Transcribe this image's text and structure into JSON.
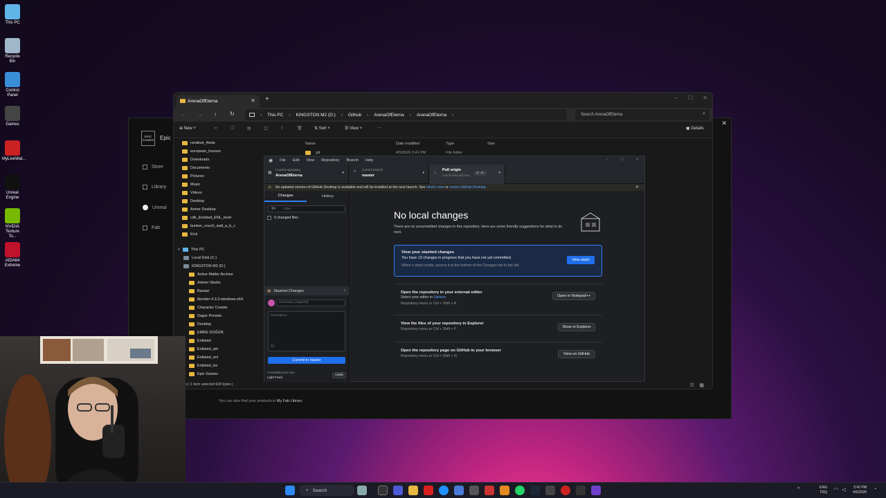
{
  "desktop": {
    "icons": [
      {
        "label": "This PC",
        "icon": "monitor-icon",
        "color": "#5fb4e8"
      },
      {
        "label": "Recycle Bin",
        "icon": "recycle-bin-icon",
        "color": "#9fb7c9"
      },
      {
        "label": "Control Panel",
        "icon": "control-panel-icon",
        "color": "#3a8ed8"
      },
      {
        "label": "Games",
        "icon": "gamepad-icon",
        "color": "#444"
      },
      {
        "label": "MyLiveWal...",
        "icon": "mylivewallpaper-icon",
        "color": "#c22"
      },
      {
        "label": "Unreal Engine",
        "icon": "unreal-engine-icon",
        "color": "#111"
      },
      {
        "label": "NVIDIA Texture To...",
        "icon": "nvidia-icon",
        "color": "#76b900"
      },
      {
        "label": "AIDA64 Extreme",
        "icon": "aida64-icon",
        "color": "#c0122a"
      }
    ]
  },
  "epic": {
    "logo": "EPIC GAMES",
    "title": "Epic",
    "nav": [
      "Store",
      "Library",
      "Unreal",
      "Fab"
    ],
    "footer": "You can also find your products in",
    "footer_link": "My Fab Library"
  },
  "explorer": {
    "tab_title": "ArenaOfEterna",
    "breadcrumb": [
      "This PC",
      "KINGSTON M2 (D:)",
      "Github",
      "ArenaOfEterna",
      "ArenaOfEterna"
    ],
    "search_placeholder": "Search ArenaOfEterna",
    "toolbar": {
      "new": "New",
      "sort": "Sort",
      "view": "View",
      "details": "Details"
    },
    "columns": {
      "name": "Name",
      "date": "Date modified",
      "type": "Type",
      "size": "Size"
    },
    "rows": [
      {
        "name": ".git",
        "date": "4/5/2026 3:41 PM",
        "type": "File folder",
        "size": ""
      }
    ],
    "quick_access": [
      "rendinst_4lods",
      "european_houses",
      "Downloads",
      "Documents",
      "Pictures",
      "Music",
      "Videos",
      "Desktop",
      "Armer Desktop",
      "cdk_Enlisted_ENL_level",
      "bunker_couch_wall_a_b_c",
      "Kick"
    ],
    "tree_root": "This PC",
    "drives": [
      "Local Disk (C:)",
      "KINGSTON M2 (D:)"
    ],
    "folders": [
      "Active Matter Archive",
      "Artmer Studio",
      "Bazaar",
      "blender-4.3.2-windows-x64",
      "Character Creator",
      "Dagor Presets",
      "Desktop",
      "EMRE DÜĞÜN",
      "Enlisted",
      "Enlisted_am",
      "Enlisted_enl",
      "Enlisted_loc",
      "Epic Games"
    ],
    "status": "ems  |  1 item selected  643 bytes  |"
  },
  "github": {
    "menu": [
      "File",
      "Edit",
      "View",
      "Repository",
      "Branch",
      "Help"
    ],
    "repo_label": "Current repository",
    "repo_name": "ArenaOfEterna",
    "branch_label": "Current branch",
    "branch_name": "master",
    "pull_label": "Pull origin",
    "pull_sub": "Last fetched just now",
    "pull_badge": "1↑ 4↓",
    "banner": "An updated version of GitHub Desktop is available and will be installed at the next launch. See",
    "banner_link1": "what's new",
    "banner_or": "or",
    "banner_link2": "restart GitHub Desktop",
    "tabs": {
      "changes": "Changes",
      "history": "History"
    },
    "filter_placeholder": "Filter",
    "changed_files": "0 changed files",
    "stashed": "Stashed Changes",
    "summary_placeholder": "Summary (required)",
    "description_placeholder": "Description",
    "commit_button": "Commit to master",
    "committed": "Committed just now",
    "committed_msg": "Light Fixed",
    "undo": "Undo",
    "heading": "No local changes",
    "intro": "There are no uncommitted changes in this repository. Here are some friendly suggestions for what to do next.",
    "stash_card": {
      "title": "View your stashed changes",
      "line": "You have 13 changes in progress that you have not yet committed.",
      "hint": "When a stash exists, access it at the bottom of the Changes tab to the left.",
      "button": "View stash"
    },
    "cards": [
      {
        "title": "Open the repository in your external editor",
        "line": "Select your editor in",
        "link": "Options",
        "hint": "Repository menu or  Ctrl + Shift + A",
        "button": "Open in Notepad++"
      },
      {
        "title": "View the files of your repository in Explorer",
        "line": "",
        "link": "",
        "hint": "Repository menu or  Ctrl + Shift + F",
        "button": "Show in Explorer"
      },
      {
        "title": "Open the repository page on GitHub in your browser",
        "line": "",
        "link": "",
        "hint": "Repository menu or  Ctrl + Shift + G",
        "button": "View on GitHub"
      }
    ]
  },
  "taskbar": {
    "search": "Search",
    "lang": "ENG",
    "region": "TRQ",
    "time": "3:42 PM",
    "date": "4/5/2026"
  }
}
